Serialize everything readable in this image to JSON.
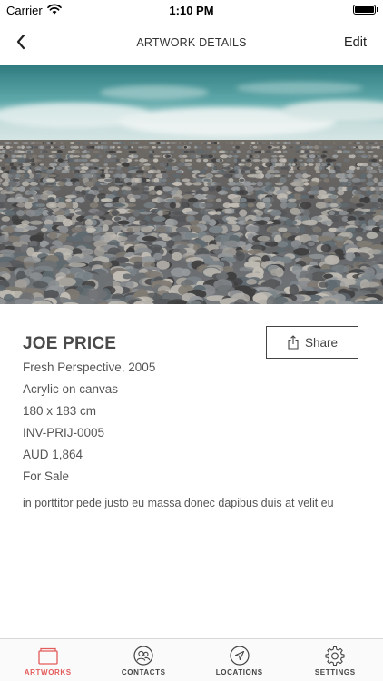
{
  "status_bar": {
    "carrier": "Carrier",
    "time": "1:10 PM"
  },
  "nav": {
    "title": "ARTWORK DETAILS",
    "edit_label": "Edit",
    "back_icon": "chevron-left-icon"
  },
  "artwork": {
    "artist": "JOE PRICE",
    "title_year": "Fresh Perspective, 2005",
    "medium": "Acrylic on canvas",
    "dimensions": "180 x 183 cm",
    "inventory_id": "INV-PRIJ-0005",
    "price": "AUD 1,864",
    "status": "For Sale",
    "description": "in porttitor pede justo eu massa donec dapibus duis at velit eu"
  },
  "share": {
    "label": "Share",
    "icon": "share-icon"
  },
  "tabs": [
    {
      "label": "ARTWORKS",
      "icon": "artworks-icon",
      "active": true
    },
    {
      "label": "CONTACTS",
      "icon": "contacts-icon",
      "active": false
    },
    {
      "label": "LOCATIONS",
      "icon": "location-arrow-icon",
      "active": false
    },
    {
      "label": "SETTINGS",
      "icon": "gear-icon",
      "active": false
    }
  ],
  "colors": {
    "accent": "#e35b5b",
    "text": "#555555",
    "sea": "#3f8f92",
    "pebble": "#7c7f82"
  }
}
